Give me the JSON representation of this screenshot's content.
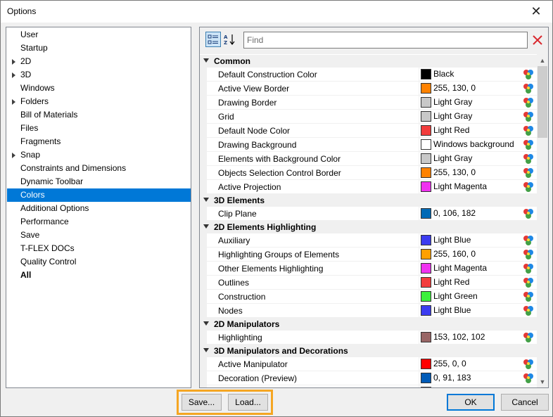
{
  "window": {
    "title": "Options",
    "close_glyph": "✕"
  },
  "tree": {
    "items": [
      {
        "label": "User",
        "expandable": false,
        "selected": false,
        "bold": false
      },
      {
        "label": "Startup",
        "expandable": false,
        "selected": false,
        "bold": false
      },
      {
        "label": "2D",
        "expandable": true,
        "selected": false,
        "bold": false
      },
      {
        "label": "3D",
        "expandable": true,
        "selected": false,
        "bold": false
      },
      {
        "label": "Windows",
        "expandable": false,
        "selected": false,
        "bold": false
      },
      {
        "label": "Folders",
        "expandable": true,
        "selected": false,
        "bold": false
      },
      {
        "label": "Bill of Materials",
        "expandable": false,
        "selected": false,
        "bold": false
      },
      {
        "label": "Files",
        "expandable": false,
        "selected": false,
        "bold": false
      },
      {
        "label": "Fragments",
        "expandable": false,
        "selected": false,
        "bold": false
      },
      {
        "label": "Snap",
        "expandable": true,
        "selected": false,
        "bold": false
      },
      {
        "label": "Constraints and Dimensions",
        "expandable": false,
        "selected": false,
        "bold": false
      },
      {
        "label": "Dynamic Toolbar",
        "expandable": false,
        "selected": false,
        "bold": false
      },
      {
        "label": "Colors",
        "expandable": false,
        "selected": true,
        "bold": false
      },
      {
        "label": "Additional Options",
        "expandable": false,
        "selected": false,
        "bold": false
      },
      {
        "label": "Performance",
        "expandable": false,
        "selected": false,
        "bold": false
      },
      {
        "label": "Save",
        "expandable": false,
        "selected": false,
        "bold": false
      },
      {
        "label": "T-FLEX DOCs",
        "expandable": false,
        "selected": false,
        "bold": false
      },
      {
        "label": "Quality Control",
        "expandable": false,
        "selected": false,
        "bold": false
      },
      {
        "label": "All",
        "expandable": false,
        "selected": false,
        "bold": true
      }
    ]
  },
  "toolbar": {
    "categorized_icon": "categorized-icon",
    "sort_icon": "sort-az-icon",
    "find_placeholder": "Find",
    "find_value": "",
    "clear_icon": "clear-icon"
  },
  "grid": {
    "rows": [
      {
        "type": "category",
        "label": "Common"
      },
      {
        "type": "prop",
        "name": "Default Construction Color",
        "value": "Black",
        "color": "#000000"
      },
      {
        "type": "prop",
        "name": "Active View Border",
        "value": "255, 130, 0",
        "color": "#ff8200"
      },
      {
        "type": "prop",
        "name": "Drawing Border",
        "value": "Light Gray",
        "color": "#c8c8c8"
      },
      {
        "type": "prop",
        "name": "Grid",
        "value": "Light Gray",
        "color": "#c8c8c8"
      },
      {
        "type": "prop",
        "name": "Default Node Color",
        "value": "Light Red",
        "color": "#f23c3c"
      },
      {
        "type": "prop",
        "name": "Drawing Background",
        "value": "Windows background",
        "color": "#ffffff"
      },
      {
        "type": "prop",
        "name": "Elements with Background Color",
        "value": "Light Gray",
        "color": "#c8c8c8"
      },
      {
        "type": "prop",
        "name": "Objects Selection Control Border",
        "value": "255, 130, 0",
        "color": "#ff8200"
      },
      {
        "type": "prop",
        "name": "Active Projection",
        "value": "Light Magenta",
        "color": "#f032f0"
      },
      {
        "type": "category",
        "label": "3D Elements"
      },
      {
        "type": "prop",
        "name": "Clip Plane",
        "value": "0, 106, 182",
        "color": "#006ab6"
      },
      {
        "type": "category",
        "label": "2D Elements Highlighting"
      },
      {
        "type": "prop",
        "name": "Auxiliary",
        "value": "Light Blue",
        "color": "#3c3cf0"
      },
      {
        "type": "prop",
        "name": "Highlighting Groups of Elements",
        "value": "255, 160, 0",
        "color": "#ffa000"
      },
      {
        "type": "prop",
        "name": "Other Elements Highlighting",
        "value": "Light Magenta",
        "color": "#f032f0"
      },
      {
        "type": "prop",
        "name": "Outlines",
        "value": "Light Red",
        "color": "#f23c3c"
      },
      {
        "type": "prop",
        "name": "Construction",
        "value": "Light Green",
        "color": "#3cf03c"
      },
      {
        "type": "prop",
        "name": "Nodes",
        "value": "Light Blue",
        "color": "#3c3cf0"
      },
      {
        "type": "category",
        "label": "2D Manipulators"
      },
      {
        "type": "prop",
        "name": "Highlighting",
        "value": "153, 102, 102",
        "color": "#996666"
      },
      {
        "type": "category",
        "label": "3D Manipulators and Decorations"
      },
      {
        "type": "prop",
        "name": "Active Manipulator",
        "value": "255, 0, 0",
        "color": "#ff0000"
      },
      {
        "type": "prop",
        "name": "Decoration (Preview)",
        "value": "0, 91, 183",
        "color": "#005bb7"
      },
      {
        "type": "prop",
        "name": "",
        "value": "",
        "color": "#008080"
      }
    ]
  },
  "buttons": {
    "save": "Save...",
    "load": "Load...",
    "ok": "OK",
    "cancel": "Cancel"
  },
  "colors": {
    "selection": "#0078d7",
    "highlight_frame": "#f5a623"
  }
}
